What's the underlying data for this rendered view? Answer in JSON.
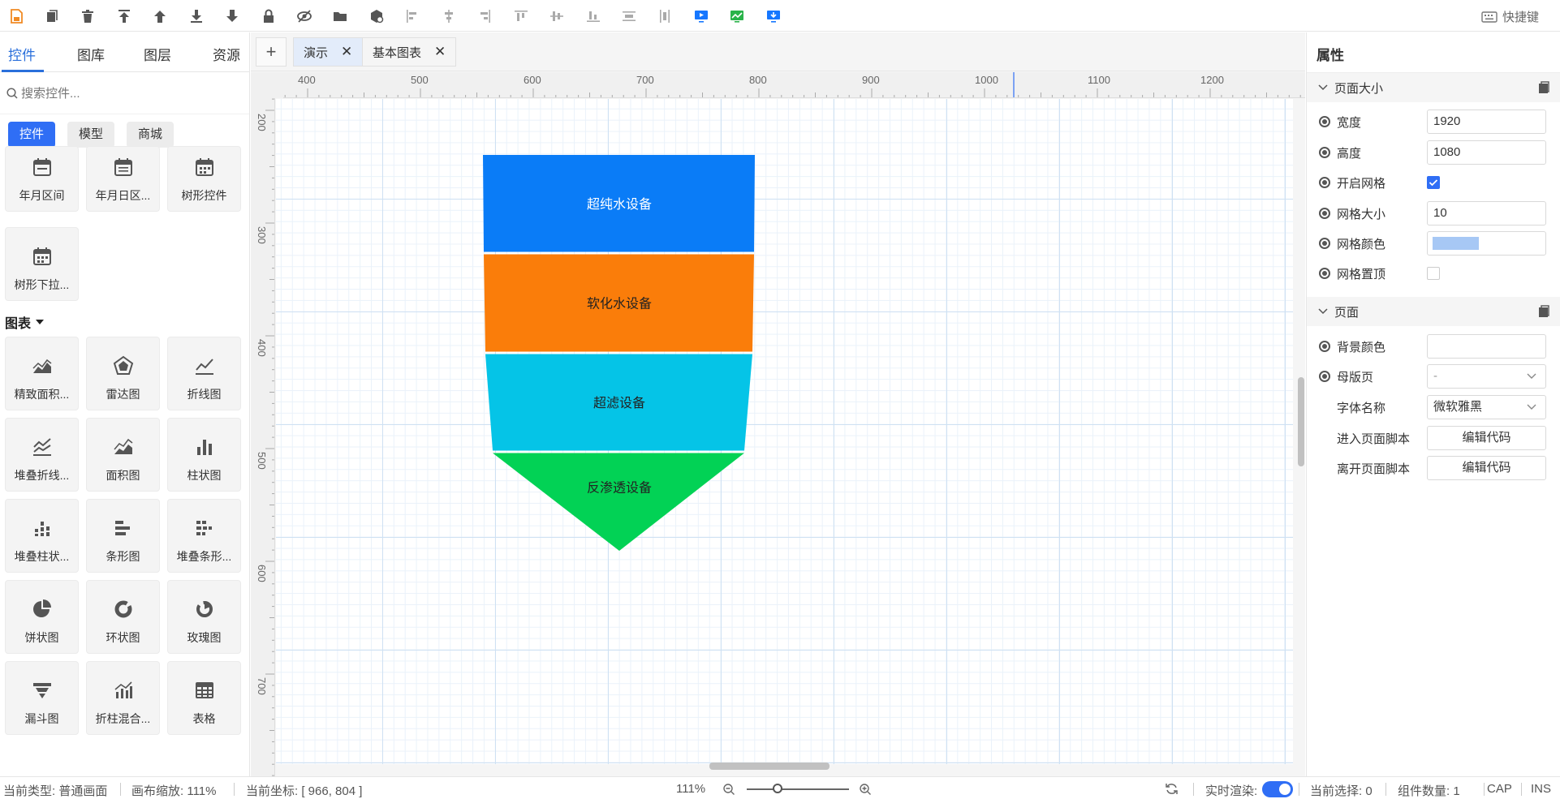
{
  "toolbar": {
    "icons": [
      "file-save-icon",
      "copy-icon",
      "delete-icon",
      "move-top-icon",
      "move-up-icon",
      "move-down-icon",
      "move-bottom-icon",
      "lock-icon",
      "hide-icon",
      "folder-icon",
      "component-icon",
      "align-left-icon",
      "align-center-h-icon",
      "align-right-icon",
      "align-top-icon",
      "align-middle-icon",
      "align-bottom-icon",
      "distribute-h-icon",
      "distribute-v-icon",
      "preview-icon",
      "chart-icon",
      "publish-icon"
    ],
    "shortcut_label": "快捷键"
  },
  "left": {
    "tabs": [
      "控件",
      "图库",
      "图层",
      "资源"
    ],
    "search_placeholder": "搜索控件...",
    "chips": [
      "控件",
      "模型",
      "商城"
    ],
    "form_tiles": [
      "年月区间",
      "年月日区...",
      "树形控件",
      "树形下拉..."
    ],
    "chart_section": "图表",
    "chart_tiles": [
      "精致面积...",
      "雷达图",
      "折线图",
      "堆叠折线...",
      "面积图",
      "柱状图",
      "堆叠柱状...",
      "条形图",
      "堆叠条形...",
      "饼状图",
      "环状图",
      "玫瑰图",
      "漏斗图",
      "折柱混合...",
      "表格"
    ]
  },
  "page_tabs": {
    "add": "+",
    "tabs": [
      {
        "label": "演示",
        "active": true
      },
      {
        "label": "基本图表",
        "active": false
      }
    ]
  },
  "rulers": {
    "h": [
      "400",
      "500",
      "600",
      "700",
      "800",
      "900",
      "1000",
      "1100",
      "1200"
    ],
    "v": [
      "200",
      "300",
      "400",
      "500",
      "600",
      "700"
    ]
  },
  "funnel": {
    "stages": [
      {
        "label": "超纯水设备",
        "color": "#0a7cf7"
      },
      {
        "label": "软化水设备",
        "color": "#fa7d0a"
      },
      {
        "label": "超滤设备",
        "color": "#05c4e7"
      },
      {
        "label": "反渗透设备",
        "color": "#02d255"
      }
    ]
  },
  "props": {
    "title": "属性",
    "page_size_section": "页面大小",
    "width_label": "宽度",
    "width_value": "1920",
    "height_label": "高度",
    "height_value": "1080",
    "grid_on_label": "开启网格",
    "grid_on": true,
    "grid_size_label": "网格大小",
    "grid_size_value": "10",
    "grid_color_label": "网格颜色",
    "grid_color": "#a7c8f5",
    "grid_top_label": "网格置顶",
    "grid_top": false,
    "page_section": "页面",
    "bg_color_label": "背景颜色",
    "master_label": "母版页",
    "master_value": "-",
    "font_label": "字体名称",
    "font_value": "微软雅黑",
    "enter_script_label": "进入页面脚本",
    "enter_script_btn": "编辑代码",
    "leave_script_label": "离开页面脚本",
    "leave_script_btn": "编辑代码"
  },
  "status": {
    "type": "当前类型:  普通画面",
    "zoom": "画布缩放:  111%",
    "coord": "当前坐标:  [ 966, 804 ]",
    "zoom_value": "111%",
    "zoom_fraction": 0.3,
    "realtime_label": "实时渲染:",
    "realtime_on": true,
    "selected": "当前选择:  0",
    "count": "组件数量:  1",
    "cap": "CAP",
    "ins": "INS"
  }
}
